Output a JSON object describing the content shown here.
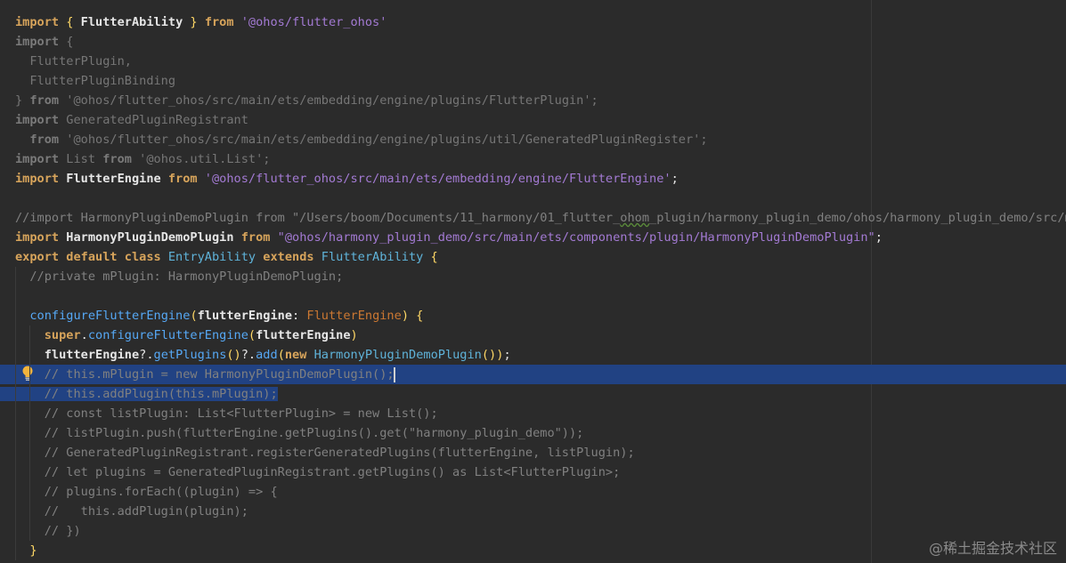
{
  "editor": {
    "lines": [
      {
        "segments": [
          [
            "kwb",
            "import "
          ],
          [
            "paren",
            "{ "
          ],
          [
            "id",
            "FlutterAbility"
          ],
          [
            "paren",
            " } "
          ],
          [
            "kwb",
            "from "
          ],
          [
            "str2",
            "'@ohos/flutter_ohos'"
          ]
        ]
      },
      {
        "segments": [
          [
            "dimkw",
            "import "
          ],
          [
            "dim",
            "{"
          ]
        ]
      },
      {
        "segments": [
          [
            "dim",
            "  FlutterPlugin,"
          ]
        ]
      },
      {
        "segments": [
          [
            "dim",
            "  FlutterPluginBinding"
          ]
        ]
      },
      {
        "segments": [
          [
            "dim",
            "} "
          ],
          [
            "dimkw",
            "from "
          ],
          [
            "dim",
            "'@ohos/flutter_ohos/src/main/ets/embedding/engine/plugins/FlutterPlugin';"
          ]
        ]
      },
      {
        "segments": [
          [
            "dimkw",
            "import "
          ],
          [
            "dim",
            "GeneratedPluginRegistrant"
          ]
        ]
      },
      {
        "segments": [
          [
            "dim",
            "  "
          ],
          [
            "dimkw",
            "from "
          ],
          [
            "dim",
            "'@ohos/flutter_ohos/src/main/ets/embedding/engine/plugins/util/GeneratedPluginRegister';"
          ]
        ]
      },
      {
        "segments": [
          [
            "dimkw",
            "import "
          ],
          [
            "dim",
            "List "
          ],
          [
            "dimkw",
            "from "
          ],
          [
            "dim",
            "'@ohos.util.List';"
          ]
        ]
      },
      {
        "segments": [
          [
            "kwb",
            "import "
          ],
          [
            "id",
            "FlutterEngine "
          ],
          [
            "kwb",
            "from "
          ],
          [
            "str2",
            "'@ohos/flutter_ohos/src/main/ets/embedding/engine/FlutterEngine'"
          ],
          [
            "idn",
            ";"
          ]
        ]
      },
      {
        "segments": []
      },
      {
        "segments": [
          [
            "cmt",
            "//import HarmonyPluginDemoPlugin from \"/Users/boom/Documents/11_harmony/01_flutter_"
          ],
          [
            "cmtw",
            "ohom"
          ],
          [
            "cmt",
            "_plugin/harmony_plugin_demo/ohos/harmony_plugin_demo/src/main"
          ]
        ]
      },
      {
        "segments": [
          [
            "kwb",
            "import "
          ],
          [
            "id",
            "HarmonyPluginDemoPlugin "
          ],
          [
            "kwb",
            "from "
          ],
          [
            "str2",
            "\"@ohos/harmony_plugin_demo/src/main/ets/components/plugin/HarmonyPluginDemoPlugin\""
          ],
          [
            "idn",
            ";"
          ]
        ]
      },
      {
        "segments": [
          [
            "kwb",
            "export default class "
          ],
          [
            "cls",
            "EntryAbility "
          ],
          [
            "kwb",
            "extends "
          ],
          [
            "cls",
            "FlutterAbility "
          ],
          [
            "paren",
            "{"
          ]
        ]
      },
      {
        "segments": [
          [
            "cmt",
            "  //private mPlugin: HarmonyPluginDemoPlugin;"
          ]
        ]
      },
      {
        "segments": []
      },
      {
        "segments": [
          [
            "idn",
            "  "
          ],
          [
            "fn",
            "configureFlutterEngine"
          ],
          [
            "paren",
            "("
          ],
          [
            "id",
            "flutterEngine"
          ],
          [
            "idn",
            ": "
          ],
          [
            "type",
            "FlutterEngine"
          ],
          [
            "paren",
            ") {"
          ]
        ]
      },
      {
        "segments": [
          [
            "idn",
            "    "
          ],
          [
            "kwb",
            "super"
          ],
          [
            "idn",
            "."
          ],
          [
            "fn",
            "configureFlutterEngine"
          ],
          [
            "paren",
            "("
          ],
          [
            "id",
            "flutterEngine"
          ],
          [
            "paren",
            ")"
          ]
        ]
      },
      {
        "segments": [
          [
            "idn",
            "    "
          ],
          [
            "id",
            "flutterEngine"
          ],
          [
            "idn",
            "?."
          ],
          [
            "fn",
            "getPlugins"
          ],
          [
            "paren",
            "()"
          ],
          [
            "idn",
            "?."
          ],
          [
            "fn",
            "add"
          ],
          [
            "paren",
            "("
          ],
          [
            "kwb",
            "new "
          ],
          [
            "cls",
            "HarmonyPluginDemoPlugin"
          ],
          [
            "paren",
            "())"
          ],
          [
            "idn",
            ";"
          ]
        ]
      },
      {
        "segments": [
          [
            "cmt",
            "    // this.mPlugin = new HarmonyPluginDemoPlugin();"
          ]
        ],
        "selection": "full",
        "caret": true
      },
      {
        "segments": [
          [
            "cmt",
            "    // this.addPlugin(this.mPlugin);"
          ]
        ],
        "selection": "partial"
      },
      {
        "segments": [
          [
            "cmt",
            "    // const listPlugin: List<FlutterPlugin> = new List();"
          ]
        ]
      },
      {
        "segments": [
          [
            "cmt",
            "    // listPlugin.push(flutterEngine.getPlugins().get(\"harmony_plugin_demo\"));"
          ]
        ]
      },
      {
        "segments": [
          [
            "cmt",
            "    // GeneratedPluginRegistrant.registerGeneratedPlugins(flutterEngine, listPlugin);"
          ]
        ]
      },
      {
        "segments": [
          [
            "cmt",
            "    // let plugins = GeneratedPluginRegistrant.getPlugins() as List<FlutterPlugin>;"
          ]
        ]
      },
      {
        "segments": [
          [
            "cmt",
            "    // plugins.forEach((plugin) => {"
          ]
        ]
      },
      {
        "segments": [
          [
            "cmt",
            "    //   this.addPlugin(plugin);"
          ]
        ]
      },
      {
        "segments": [
          [
            "cmt",
            "    // })"
          ]
        ]
      },
      {
        "segments": [
          [
            "idn",
            "  "
          ],
          [
            "paren",
            "}"
          ]
        ]
      }
    ],
    "gutter_icon": "lightbulb-icon"
  },
  "watermark": "@稀土掘金技术社区",
  "colors": {
    "background": "#2b2b2b",
    "selection": "#214283",
    "keyword": "#d7a45b",
    "string": "#a37ad3",
    "function": "#56a8f5",
    "class": "#5fb3d9",
    "comment": "#808080"
  }
}
